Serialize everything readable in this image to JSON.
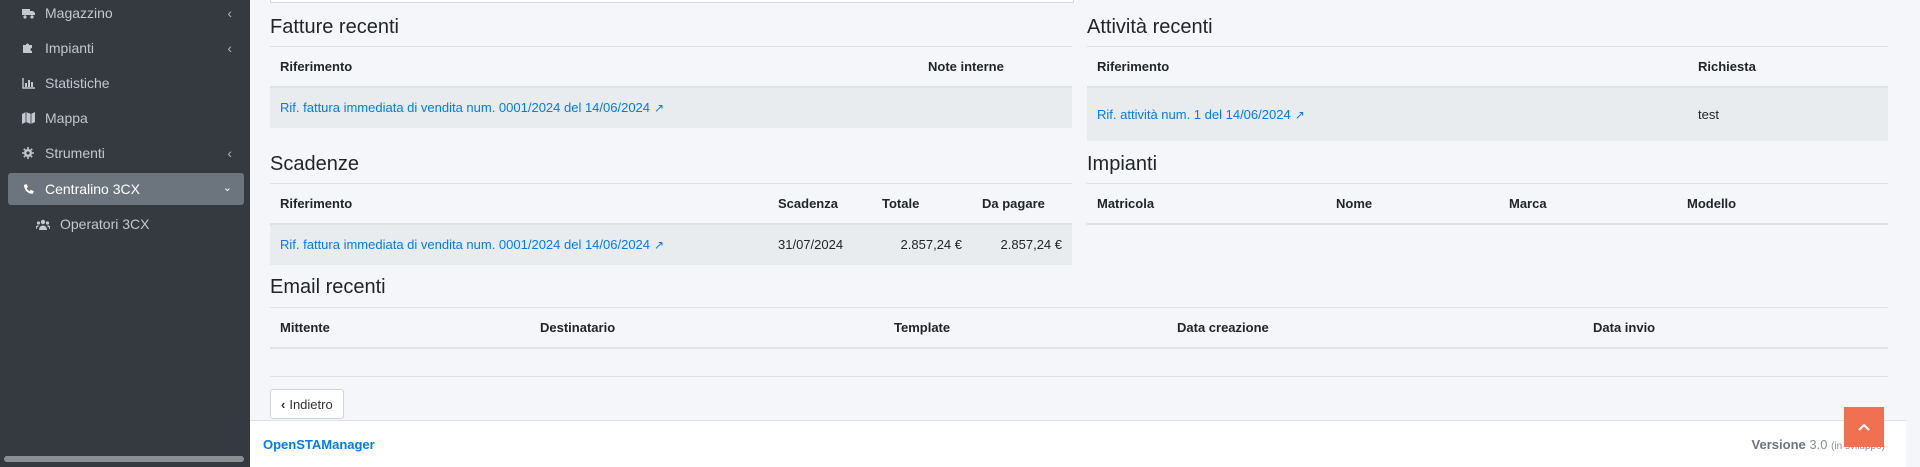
{
  "sidebar": {
    "items": [
      {
        "label": "Magazzino",
        "icon": "truck-icon"
      },
      {
        "label": "Impianti",
        "icon": "puzzle-icon"
      },
      {
        "label": "Statistiche",
        "icon": "bar-chart-icon"
      },
      {
        "label": "Mappa",
        "icon": "map-icon"
      },
      {
        "label": "Strumenti",
        "icon": "gear-icon"
      },
      {
        "label": "Centralino 3CX",
        "icon": "phone-icon"
      }
    ],
    "sub_items": [
      {
        "label": "Operatori 3CX",
        "icon": "users-icon"
      }
    ]
  },
  "fatture": {
    "title": "Fatture recenti",
    "headers": [
      "Riferimento",
      "Note interne"
    ],
    "rows": [
      {
        "riferimento": "Rif. fattura immediata di vendita num. 0001/2024 del 14/06/2024",
        "note": ""
      }
    ]
  },
  "attivita": {
    "title": "Attività recenti",
    "headers": [
      "Riferimento",
      "Richiesta"
    ],
    "rows": [
      {
        "riferimento": "Rif. attività num. 1 del 14/06/2024",
        "richiesta": "test"
      }
    ]
  },
  "scadenze": {
    "title": "Scadenze",
    "headers": [
      "Riferimento",
      "Scadenza",
      "Totale",
      "Da pagare"
    ],
    "rows": [
      {
        "riferimento": "Rif. fattura immediata di vendita num. 0001/2024 del 14/06/2024",
        "scadenza": "31/07/2024",
        "totale": "2.857,24 €",
        "da_pagare": "2.857,24 €"
      }
    ]
  },
  "impianti": {
    "title": "Impianti",
    "headers": [
      "Matricola",
      "Nome",
      "Marca",
      "Modello"
    ]
  },
  "email": {
    "title": "Email recenti",
    "headers": [
      "Mittente",
      "Destinatario",
      "Template",
      "Data creazione",
      "Data invio"
    ]
  },
  "back_button": "Indietro",
  "footer": {
    "brand": "OpenSTAManager",
    "version_label": "Versione",
    "version_number": "3.0",
    "version_note": "(in sviluppo)"
  },
  "colors": {
    "sidebar_bg": "#343a40",
    "link": "#007bff",
    "scroll_top": "#f27052"
  }
}
